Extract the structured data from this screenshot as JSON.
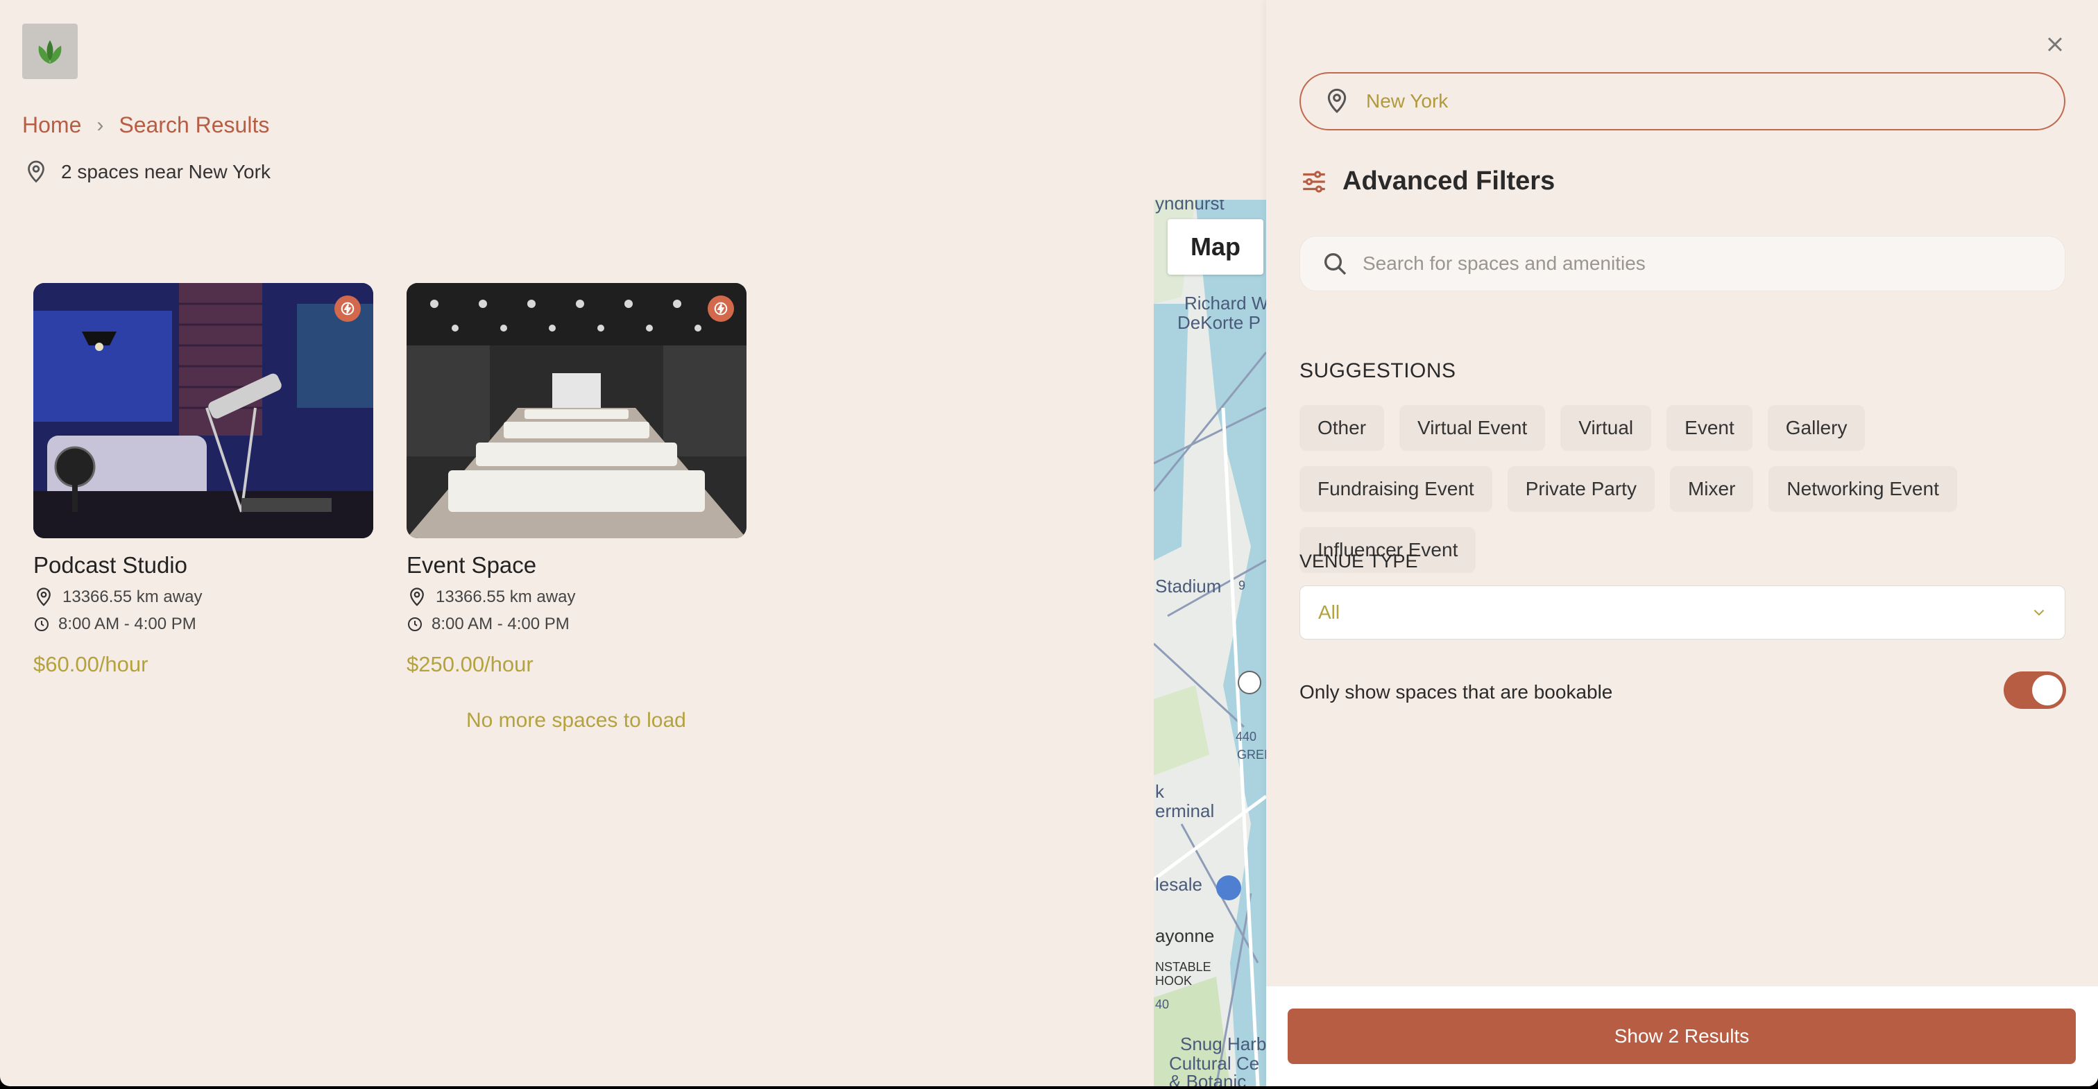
{
  "breadcrumb": {
    "home": "Home",
    "current": "Search Results"
  },
  "results": {
    "summary": "2 spaces near New York"
  },
  "spaces": [
    {
      "title": "Podcast Studio",
      "distance": "13366.55 km away",
      "hours": "8:00 AM - 4:00 PM",
      "price": "$60.00/hour"
    },
    {
      "title": "Event Space",
      "distance": "13366.55 km away",
      "hours": "8:00 AM - 4:00 PM",
      "price": "$250.00/hour"
    }
  ],
  "no_more": "No more spaces to load",
  "map": {
    "button": "Map",
    "labels": [
      "yndhurst",
      "Richard W",
      "DeKorte P",
      "Stadium",
      "9",
      "440",
      "GREI",
      "k",
      "erminal",
      "lesale",
      "ayonne",
      "NSTABLE",
      "HOOK",
      "40",
      "Snug Harb",
      "Cultural Ce",
      "& Botanic"
    ]
  },
  "filters": {
    "location_value": "New York",
    "title": "Advanced Filters",
    "search_placeholder": "Search for spaces and amenities",
    "suggestions_heading": "SUGGESTIONS",
    "suggestions": [
      "Other",
      "Virtual Event",
      "Virtual",
      "Event",
      "Gallery",
      "Fundraising Event",
      "Private Party",
      "Mixer",
      "Networking Event",
      "Influencer Event"
    ],
    "venue_heading": "VENUE TYPE",
    "venue_value": "All",
    "bookable_label": "Only show spaces that are bookable",
    "bookable_on": true,
    "show_button": "Show 2  Results"
  },
  "colors": {
    "accent": "#b65d44",
    "gold": "#b4a23e",
    "background": "#f5ece5"
  }
}
